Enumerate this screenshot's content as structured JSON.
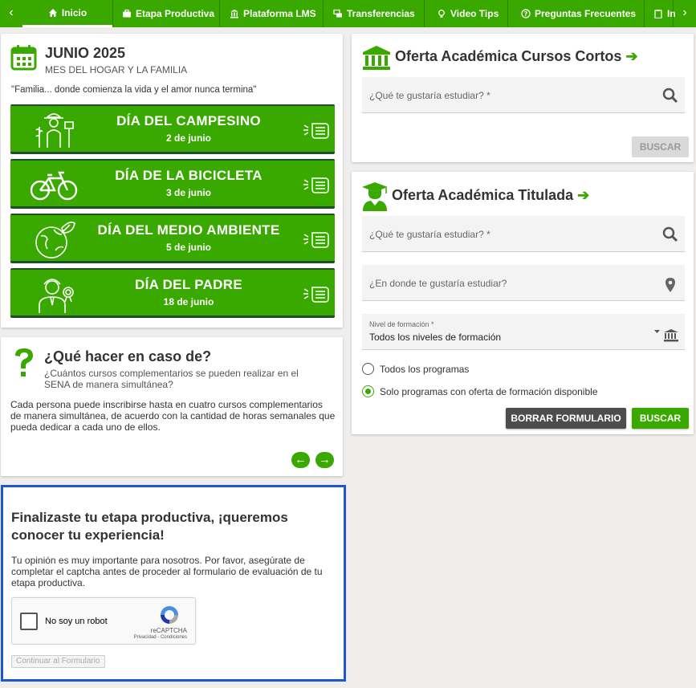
{
  "nav": {
    "left_arrow": "‹",
    "right_arrow": "›",
    "items": [
      {
        "label": "Inicio",
        "icon": "home-icon"
      },
      {
        "label": "Etapa Productiva",
        "icon": "briefcase-icon"
      },
      {
        "label": "Plataforma LMS",
        "icon": "institution-icon"
      },
      {
        "label": "Transferencias",
        "icon": "transfer-icon"
      },
      {
        "label": "Video Tips",
        "icon": "lightbulb-icon"
      },
      {
        "label": "Preguntas Frecuentes",
        "icon": "question-circle-icon"
      },
      {
        "label": "In",
        "icon": "clipboard-icon"
      }
    ]
  },
  "calendar": {
    "title": "JUNIO 2025",
    "subtitle": "MES DEL HOGAR Y LA FAMILIA",
    "quote": "\"Familia... donde comienza la vida y el amor nunca termina\"",
    "banners": [
      {
        "title": "DÍA DEL CAMPESINO",
        "date": "2 de junio",
        "icon": "farmer-icon"
      },
      {
        "title": "DÍA DE LA BICICLETA",
        "date": "3 de junio",
        "icon": "bicycle-icon"
      },
      {
        "title": "DÍA DEL MEDIO AMBIENTE",
        "date": "5 de junio",
        "icon": "earth-leaf-icon"
      },
      {
        "title": "DÍA DEL PADRE",
        "date": "18 de junio",
        "icon": "father-icon"
      }
    ]
  },
  "faq": {
    "title": "¿Qué hacer en caso de?",
    "question": "¿Cuántos cursos complementarios se pueden realizar en el SENA de manera simultánea?",
    "answer": "Cada persona puede inscribirse hasta en cuatro cursos complementarios de manera simultánea, de acuerdo con la cantidad de horas semanales que pueda dedicar a cada uno de ellos.",
    "prev": "←",
    "next": "→"
  },
  "feedback": {
    "title": "Finalizaste tu etapa productiva, ¡queremos conocer tu experiencia!",
    "body": "Tu opinión es muy importante para nosotros. Por favor, asegúrate de completar el captcha antes de proceder al formulario de evaluación de tu etapa productiva.",
    "captcha_label": "No soy un robot",
    "captcha_brand": "reCAPTCHA",
    "captcha_terms": "Privacidad - Condiciones",
    "continue_label": "Continuar al Formulario"
  },
  "short_courses": {
    "title": "Oferta Académica Cursos Cortos",
    "arrow": "➔",
    "search_placeholder": "¿Qué te gustaría estudiar? *",
    "search_button": "BUSCAR"
  },
  "titled": {
    "title": "Oferta Académica Titulada",
    "arrow": "➔",
    "search_placeholder": "¿Qué te gustaría estudiar? *",
    "location_placeholder": "¿En donde te gustaría estudiar?",
    "level_label": "Nivel de formación *",
    "level_value": "Todos los niveles de formación",
    "radio_all": "Todos los programas",
    "radio_available": "Solo programas con oferta de formación disponible",
    "clear_button": "BORRAR FORMULARIO",
    "search_button": "BUSCAR"
  },
  "colors": {
    "brand_green": "#39a900",
    "dark_green": "#1f4e2b",
    "focus_blue": "#1e56d1",
    "clear_button": "#4d4d4d"
  }
}
